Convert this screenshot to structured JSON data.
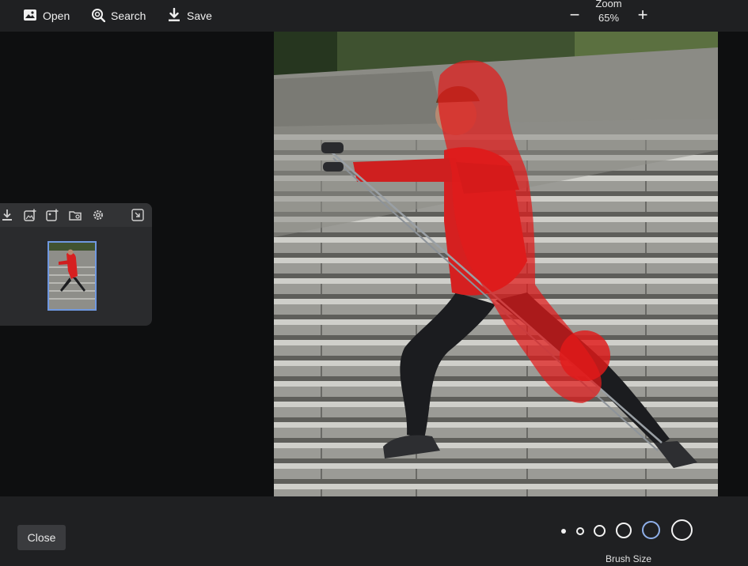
{
  "toolbar": {
    "open_label": "Open",
    "search_label": "Search",
    "save_label": "Save",
    "zoom_label": "Zoom",
    "zoom_value": "65%",
    "zoom_minus": "−",
    "zoom_plus": "+"
  },
  "icons": {
    "open": "image-icon",
    "search": "search-icon",
    "save": "download-icon"
  },
  "thumbnail_panel": {
    "tools": [
      "download-icon",
      "add-image-icon",
      "add-image-alt-icon",
      "folder-icon",
      "gear-icon",
      "minimize-icon"
    ]
  },
  "bottom": {
    "close_label": "Close",
    "brush_size_label": "Brush Size",
    "brush_sizes": 6,
    "selected_brush_index": 4
  },
  "colors": {
    "mask_red": "#e21a1a",
    "accent_blue": "#8fb0ea"
  }
}
